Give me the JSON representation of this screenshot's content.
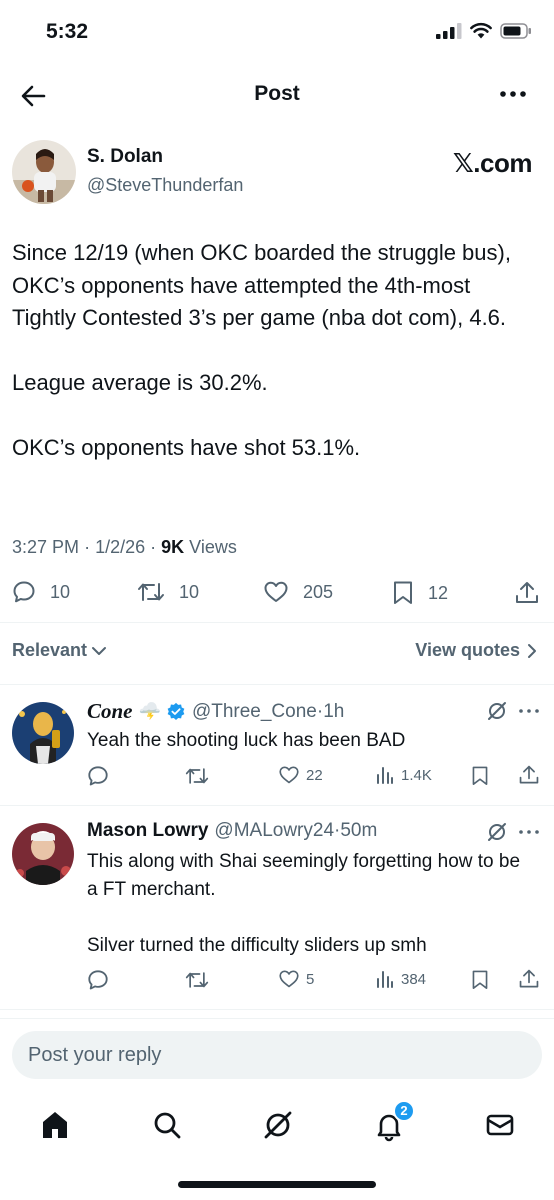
{
  "status_bar": {
    "time": "5:32"
  },
  "header": {
    "title": "Post"
  },
  "post": {
    "author_name": "S. Dolan",
    "author_handle": "@SteveThunderfan",
    "source_label": "𝕏.com",
    "paragraph_1": "Since 12/19 (when OKC boarded the struggle bus), OKC’s opponents have attempted the 4th-most Tightly Contested 3’s per game (nba dot com), 4.6.",
    "paragraph_2": "League average is 30.2%.",
    "paragraph_3": "OKC’s opponents have shot 53.1%.",
    "time": "3:27 PM",
    "date": "1/2/26",
    "views_count": "9K",
    "views_label": "Views",
    "replies": "10",
    "reposts": "10",
    "likes": "205",
    "bookmarks": "12"
  },
  "sort": {
    "label": "Relevant",
    "view_quotes": "View quotes"
  },
  "replies": [
    {
      "name": "Cone",
      "emoji": "🌩️",
      "verified": true,
      "handle": "@Three_Cone",
      "time": "1h",
      "text_1": "Yeah the shooting luck has been BAD",
      "likes": "22",
      "views": "1.4K"
    },
    {
      "name": "Mason Lowry",
      "verified": false,
      "handle": "@MALowry24",
      "time": "50m",
      "text_1": "This along with Shai seemingly forgetting how to be a FT merchant.",
      "text_2": "Silver turned the difficulty sliders up smh",
      "likes": "5",
      "views": "384"
    }
  ],
  "composer": {
    "placeholder": "Post your reply"
  },
  "tabbar": {
    "notifications_badge": "2"
  },
  "colors": {
    "text": "#0f1419",
    "secondary": "#536471",
    "accent": "#1d9bf0",
    "divider": "#eff3f4"
  }
}
